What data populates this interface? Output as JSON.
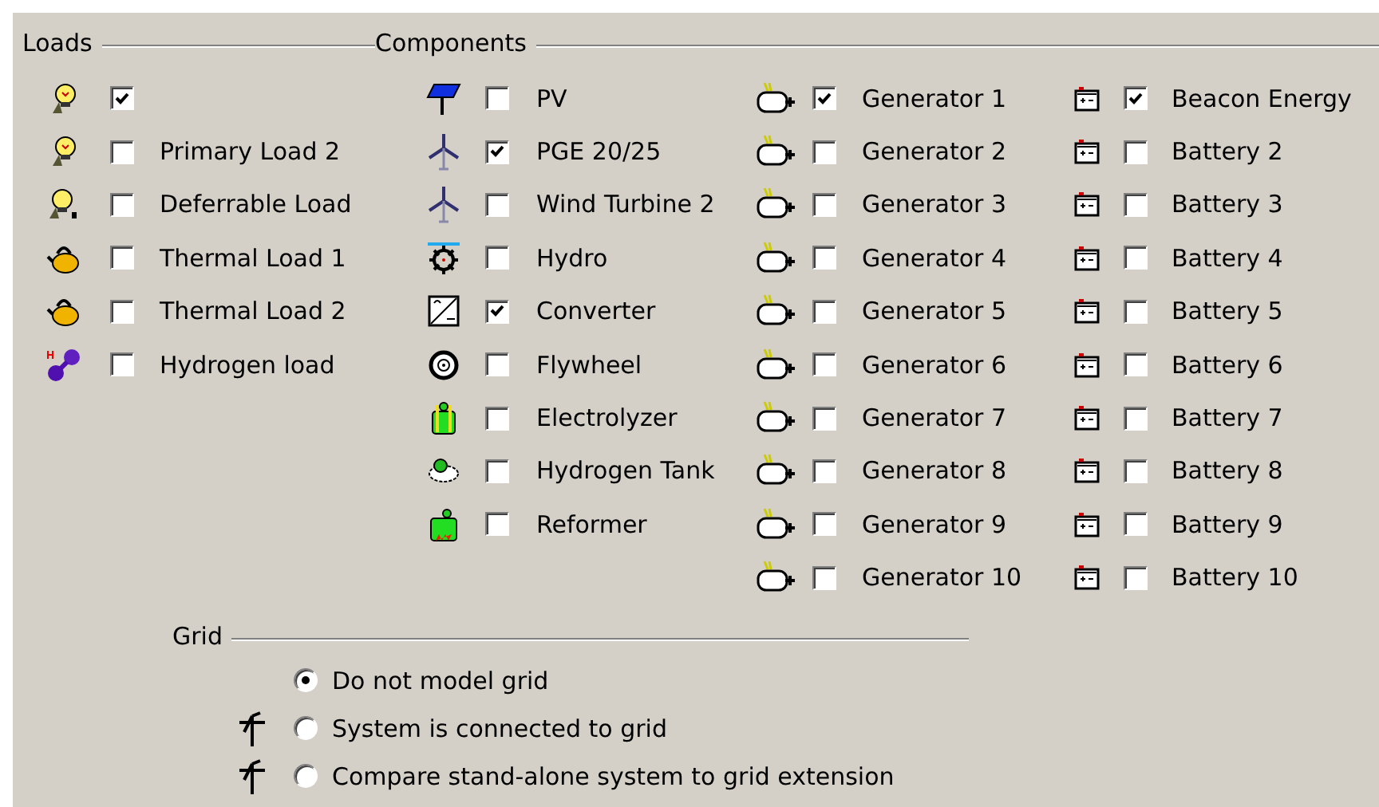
{
  "loads": {
    "title": "Loads",
    "items": [
      {
        "kind": "primary",
        "checked": true
      },
      {
        "kind": "primary",
        "label": "Primary Load 2",
        "checked": false
      },
      {
        "kind": "deferrable",
        "label": "Deferrable Load",
        "checked": false
      },
      {
        "kind": "thermal",
        "label": "Thermal Load 1",
        "checked": false
      },
      {
        "kind": "thermal",
        "label": "Thermal Load 2",
        "checked": false
      },
      {
        "kind": "hydrogen",
        "label": "Hydrogen load",
        "checked": false
      }
    ]
  },
  "components": {
    "title": "Components",
    "columns": [
      [
        {
          "kind": "pv",
          "label": "PV",
          "checked": false
        },
        {
          "kind": "wind",
          "label": "PGE 20/25",
          "checked": true
        },
        {
          "kind": "wind",
          "label": "Wind Turbine 2",
          "checked": false
        },
        {
          "kind": "hydro",
          "label": "Hydro",
          "checked": false
        },
        {
          "kind": "converter",
          "label": "Converter",
          "checked": true
        },
        {
          "kind": "flywheel",
          "label": "Flywheel",
          "checked": false
        },
        {
          "kind": "electrolyzer",
          "label": "Electrolyzer",
          "checked": false
        },
        {
          "kind": "tank",
          "label": "Hydrogen Tank",
          "checked": false
        },
        {
          "kind": "reformer",
          "label": "Reformer",
          "checked": false
        }
      ],
      [
        {
          "kind": "generator",
          "label": "Generator 1",
          "checked": true
        },
        {
          "kind": "generator",
          "label": "Generator 2",
          "checked": false
        },
        {
          "kind": "generator",
          "label": "Generator 3",
          "checked": false
        },
        {
          "kind": "generator",
          "label": "Generator 4",
          "checked": false
        },
        {
          "kind": "generator",
          "label": "Generator 5",
          "checked": false
        },
        {
          "kind": "generator",
          "label": "Generator 6",
          "checked": false
        },
        {
          "kind": "generator",
          "label": "Generator 7",
          "checked": false
        },
        {
          "kind": "generator",
          "label": "Generator 8",
          "checked": false
        },
        {
          "kind": "generator",
          "label": "Generator 9",
          "checked": false
        },
        {
          "kind": "generator",
          "label": "Generator 10",
          "checked": false
        }
      ],
      [
        {
          "kind": "battery",
          "label": "Beacon Energy",
          "checked": true
        },
        {
          "kind": "battery",
          "label": "Battery 2",
          "checked": false
        },
        {
          "kind": "battery",
          "label": "Battery 3",
          "checked": false
        },
        {
          "kind": "battery",
          "label": "Battery 4",
          "checked": false
        },
        {
          "kind": "battery",
          "label": "Battery 5",
          "checked": false
        },
        {
          "kind": "battery",
          "label": "Battery 6",
          "checked": false
        },
        {
          "kind": "battery",
          "label": "Battery 7",
          "checked": false
        },
        {
          "kind": "battery",
          "label": "Battery 8",
          "checked": false
        },
        {
          "kind": "battery",
          "label": "Battery 9",
          "checked": false
        },
        {
          "kind": "battery",
          "label": "Battery 10",
          "checked": false
        }
      ]
    ]
  },
  "grid": {
    "title": "Grid",
    "options": [
      {
        "kind": "plain",
        "label": "Do not model grid",
        "selected": true
      },
      {
        "kind": "tower",
        "label": "System is connected to grid",
        "selected": false
      },
      {
        "kind": "tower",
        "label": "Compare stand-alone system to grid extension",
        "selected": false
      }
    ]
  }
}
